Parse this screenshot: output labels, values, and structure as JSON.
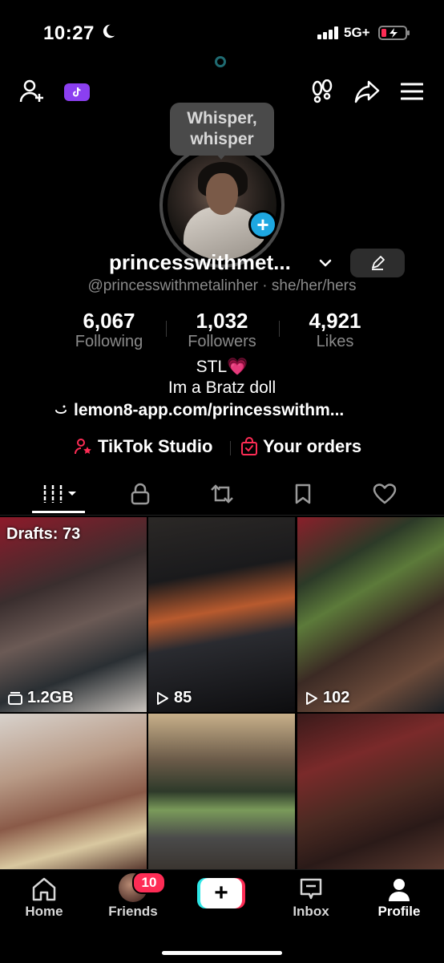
{
  "status_bar": {
    "time": "10:27",
    "network": "5G+"
  },
  "profile": {
    "note_bubble": "Whisper, whisper",
    "name": "princesswithmet...",
    "handle_line": "@princesswithmetalinher · she/her/hers",
    "stats": [
      {
        "value": "6,067",
        "label": "Following"
      },
      {
        "value": "1,032",
        "label": "Followers"
      },
      {
        "value": "4,921",
        "label": "Likes"
      }
    ],
    "bio_line1": "STL💗",
    "bio_line2": "Im a Bratz doll",
    "link": "lemon8-app.com/princesswithm..."
  },
  "actions": {
    "studio": "TikTok Studio",
    "orders": "Your orders"
  },
  "tabs": [
    "videos",
    "private",
    "reposts",
    "favorites",
    "liked"
  ],
  "grid": [
    {
      "overlay": "1.2GB",
      "overlay_icon": "folder-icon",
      "drafts": "Drafts: 73"
    },
    {
      "overlay": "85",
      "overlay_icon": "play-icon"
    },
    {
      "overlay": "102",
      "overlay_icon": "play-icon"
    },
    {
      "overlay": ""
    },
    {
      "overlay": ""
    },
    {
      "overlay": ""
    }
  ],
  "nav": {
    "home": "Home",
    "friends": "Friends",
    "friends_badge": "10",
    "inbox": "Inbox",
    "profile": "Profile"
  },
  "colors": {
    "accent_pink": "#fe2c55",
    "accent_cyan": "#2ee6e6",
    "add_blue": "#1ea7e1",
    "tiktok_purple": "#8b3ff0"
  }
}
